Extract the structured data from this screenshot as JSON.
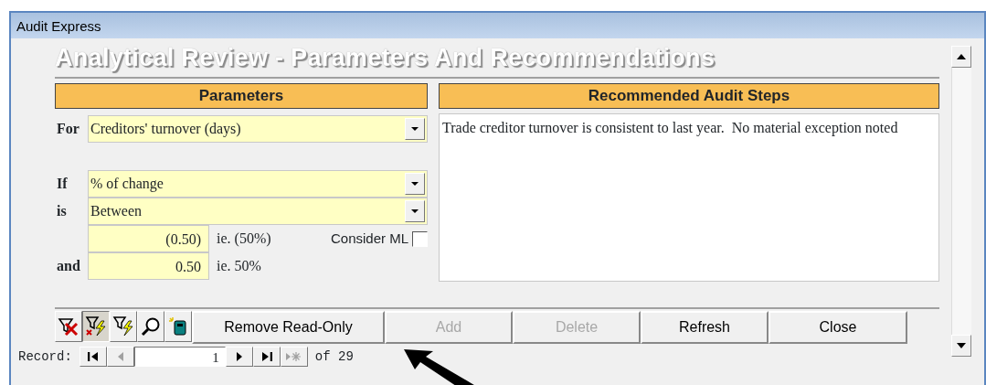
{
  "window": {
    "title": "Audit Express"
  },
  "heading": "Analytical Review - Parameters And Recommendations",
  "parameters": {
    "title": "Parameters",
    "for": {
      "label": "For",
      "value": "Creditors' turnover (days)"
    },
    "if": {
      "label": "If",
      "value": "% of change"
    },
    "is": {
      "label": "is",
      "value": "Between"
    },
    "lower": {
      "value": "(0.50)",
      "note": "ie. (50%)"
    },
    "upper": {
      "label": "and",
      "value": "0.50",
      "note": "ie. 50%"
    },
    "consider_ml": {
      "label": "Consider ML",
      "checked": false
    }
  },
  "recommendations": {
    "title": "Recommended Audit Steps",
    "text": "Trade creditor turnover is consistent to last year.  No material exception noted"
  },
  "toolbar": {
    "icon_buttons": [
      {
        "kind": "remove-filter",
        "pressed": false
      },
      {
        "kind": "filter-selection",
        "pressed": true
      },
      {
        "kind": "filter-form",
        "pressed": false
      },
      {
        "kind": "find",
        "pressed": false
      },
      {
        "kind": "notebook",
        "pressed": false
      }
    ],
    "buttons": [
      {
        "label": "Remove Read-Only",
        "disabled": false
      },
      {
        "label": "Add",
        "disabled": true
      },
      {
        "label": "Delete",
        "disabled": true
      },
      {
        "label": "Refresh",
        "disabled": false
      },
      {
        "label": "Close",
        "disabled": false
      }
    ]
  },
  "record_nav": {
    "label": "Record:",
    "buttons": [
      {
        "kind": "first",
        "disabled": false
      },
      {
        "kind": "previous",
        "disabled": true
      },
      {
        "kind": "next",
        "disabled": false
      },
      {
        "kind": "last",
        "disabled": false
      },
      {
        "kind": "new",
        "disabled": true
      }
    ],
    "current": "1",
    "total": "of 29"
  }
}
